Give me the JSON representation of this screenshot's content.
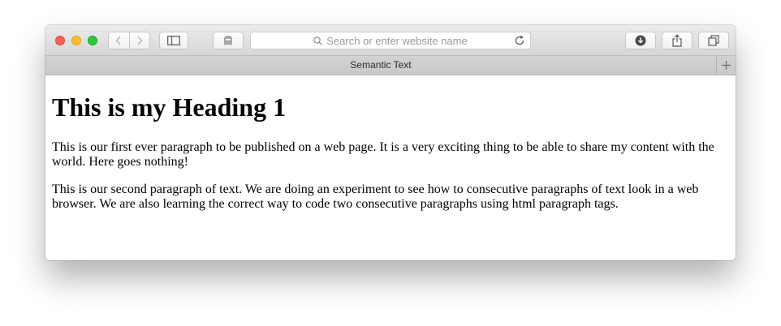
{
  "browser": {
    "address_placeholder": "Search or enter website name",
    "tab_title": "Semantic Text",
    "new_tab_symbol": "+"
  },
  "page": {
    "heading": "This is my Heading 1",
    "paragraphs": [
      "This is our first ever paragraph to be published on a web page. It is a very exciting thing to be able to share my content with the world. Here goes nothing!",
      "This is our second paragraph of text. We are doing an experiment to see how to consecutive paragraphs of text look in a web browser. We are also learning the correct way to code two consecutive paragraphs using html paragraph tags."
    ]
  },
  "icons": {
    "back": "chevron-left-icon",
    "forward": "chevron-right-icon",
    "sidebar": "sidebar-icon",
    "privacy": "ghost-icon",
    "search": "search-icon",
    "reload": "reload-icon",
    "downloads": "download-icon",
    "share": "share-icon",
    "tabs": "tabs-overview-icon"
  },
  "colors": {
    "close": "#fc5f57",
    "minimize": "#fdbc2e",
    "zoom": "#28c840"
  }
}
